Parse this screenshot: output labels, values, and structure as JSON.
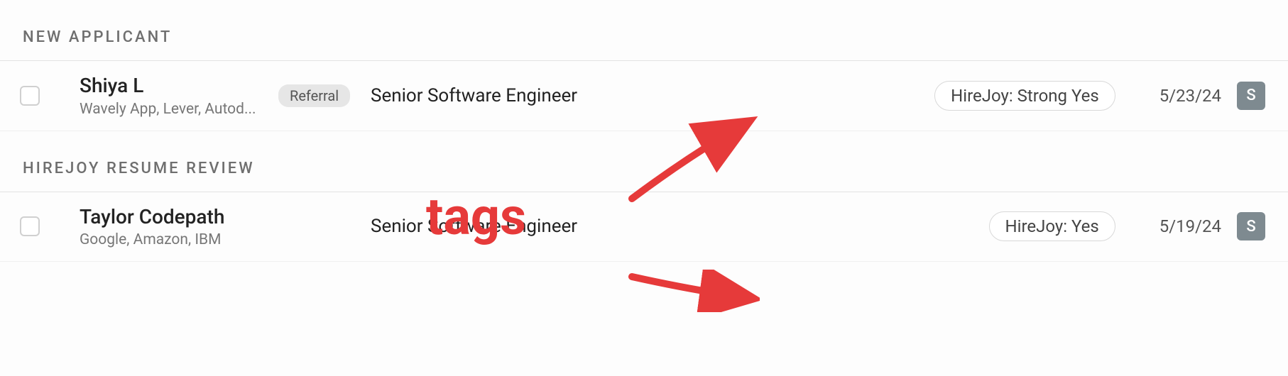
{
  "sections": [
    {
      "title": "NEW APPLICANT",
      "rows": [
        {
          "name": "Shiya L",
          "sub": "Wavely App, Lever, Autod...",
          "badge": "Referral",
          "role": "Senior Software Engineer",
          "tag": "HireJoy: Strong Yes",
          "date": "5/23/24",
          "avatar": "S"
        }
      ]
    },
    {
      "title": "HIREJOY RESUME REVIEW",
      "rows": [
        {
          "name": "Taylor Codepath",
          "sub": "Google, Amazon, IBM",
          "badge": "",
          "role": "Senior Software Engineer",
          "tag": "HireJoy: Yes",
          "date": "5/19/24",
          "avatar": "S"
        }
      ]
    }
  ],
  "annotation": {
    "label": "tags",
    "color": "#e63a3a"
  }
}
